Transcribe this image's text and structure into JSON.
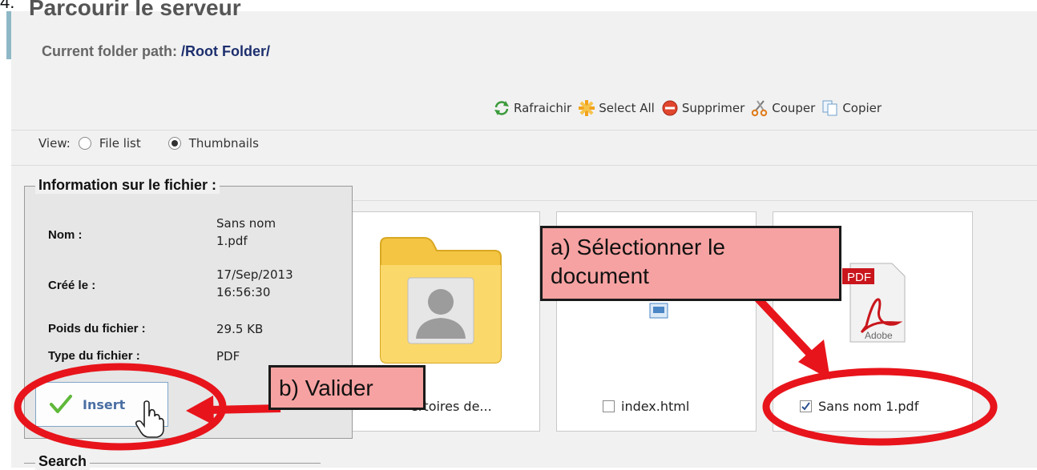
{
  "step_number": "4.",
  "page_title": "Parcourir le serveur",
  "path": {
    "label": "Current folder path: ",
    "value": "/Root Folder/"
  },
  "toolbar": [
    {
      "icon": "refresh-icon",
      "label": "Rafraichir"
    },
    {
      "icon": "select-all-icon",
      "label": "Select All"
    },
    {
      "icon": "delete-icon",
      "label": "Supprimer"
    },
    {
      "icon": "cut-icon",
      "label": "Couper"
    },
    {
      "icon": "copy-icon",
      "label": "Copier"
    }
  ],
  "view": {
    "label": "View:",
    "options": [
      "File list",
      "Thumbnails"
    ],
    "selected": "Thumbnails"
  },
  "file_info": {
    "title": "Information sur le fichier :",
    "rows": [
      {
        "label": "Nom :",
        "value_lines": [
          "Sans nom",
          "1.pdf"
        ]
      },
      {
        "label": "Créé le :",
        "value_lines": [
          "17/Sep/2013",
          "16:56:30"
        ]
      },
      {
        "label": "Poids du fichier :",
        "value_lines": [
          "29.5 KB"
        ]
      },
      {
        "label": "Type du fichier :",
        "value_lines": [
          "PDF"
        ]
      }
    ],
    "insert_label": "Insert"
  },
  "thumbnails": [
    {
      "caption": "ertoires de...",
      "icon": "folder-user-icon",
      "checked": false
    },
    {
      "caption": "index.html",
      "icon": "html-file-icon",
      "checked": false
    },
    {
      "caption": "Sans nom 1.pdf",
      "icon": "pdf-file-icon",
      "checked": true
    }
  ],
  "pdf_icon_texts": {
    "badge": "PDF",
    "brand": "Adobe"
  },
  "callouts": {
    "a": [
      "a) Sélectionner le",
      "document"
    ],
    "b": "b) Valider"
  },
  "search_title": "Search",
  "colors": {
    "annotation_red": "#e8141b",
    "callout_fill": "#f7a2a2",
    "path_blue": "#1d2f6e",
    "insert_text": "#4a6fa3"
  }
}
